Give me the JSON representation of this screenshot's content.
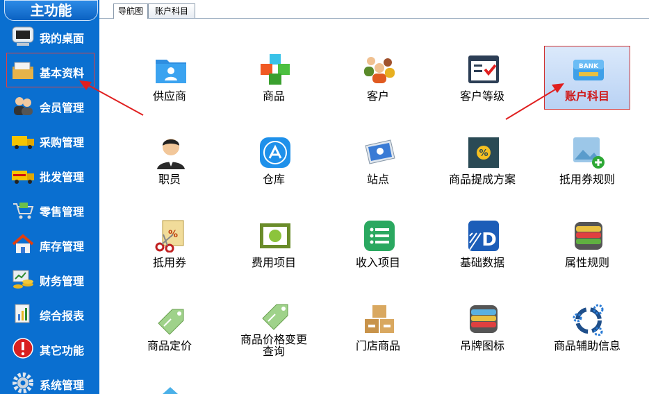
{
  "sidebar": {
    "title": "主功能",
    "items": [
      {
        "label": "我的桌面",
        "icon": "monitor-icon"
      },
      {
        "label": "基本资料",
        "icon": "folder-icon"
      },
      {
        "label": "会员管理",
        "icon": "users-icon"
      },
      {
        "label": "采购管理",
        "icon": "truck-icon"
      },
      {
        "label": "批发管理",
        "icon": "delivery-truck-icon"
      },
      {
        "label": "零售管理",
        "icon": "cart-icon"
      },
      {
        "label": "库存管理",
        "icon": "house-icon"
      },
      {
        "label": "财务管理",
        "icon": "money-icon"
      },
      {
        "label": "综合报表",
        "icon": "report-icon"
      },
      {
        "label": "其它功能",
        "icon": "alert-icon"
      },
      {
        "label": "系统管理",
        "icon": "gear-icon"
      }
    ]
  },
  "tabs": [
    {
      "label": "导航图",
      "active": true
    },
    {
      "label": "账户科目",
      "active": false
    }
  ],
  "grid": {
    "items": [
      {
        "label": "供应商",
        "icon": "folder-contact-icon"
      },
      {
        "label": "商品",
        "icon": "cubes-icon"
      },
      {
        "label": "客户",
        "icon": "customers-icon"
      },
      {
        "label": "客户等级",
        "icon": "checklist-icon"
      },
      {
        "label": "账户科目",
        "icon": "bank-card-icon",
        "selected": true
      },
      {
        "label": "职员",
        "icon": "employee-icon"
      },
      {
        "label": "仓库",
        "icon": "app-store-icon"
      },
      {
        "label": "站点",
        "icon": "site-icon"
      },
      {
        "label": "商品提成方案",
        "icon": "commission-icon"
      },
      {
        "label": "抵用券规则",
        "icon": "image-add-icon"
      },
      {
        "label": "抵用券",
        "icon": "coupon-icon"
      },
      {
        "label": "费用项目",
        "icon": "expense-icon"
      },
      {
        "label": "收入项目",
        "icon": "list-icon"
      },
      {
        "label": "基础数据",
        "icon": "data-d-icon"
      },
      {
        "label": "属性规则",
        "icon": "stack-icon"
      },
      {
        "label": "商品定价",
        "icon": "price-tag-icon"
      },
      {
        "label": "商品价格变更",
        "label2": "查询",
        "icon": "price-tag-change-icon"
      },
      {
        "label": "门店商品",
        "icon": "boxes-icon"
      },
      {
        "label": "吊牌图标",
        "icon": "tag-stack-icon"
      },
      {
        "label": "商品辅助信息",
        "icon": "gear-ring-icon"
      }
    ]
  },
  "colors": {
    "sidebar_bg": "#0a6fd0",
    "highlight": "#d03030"
  }
}
